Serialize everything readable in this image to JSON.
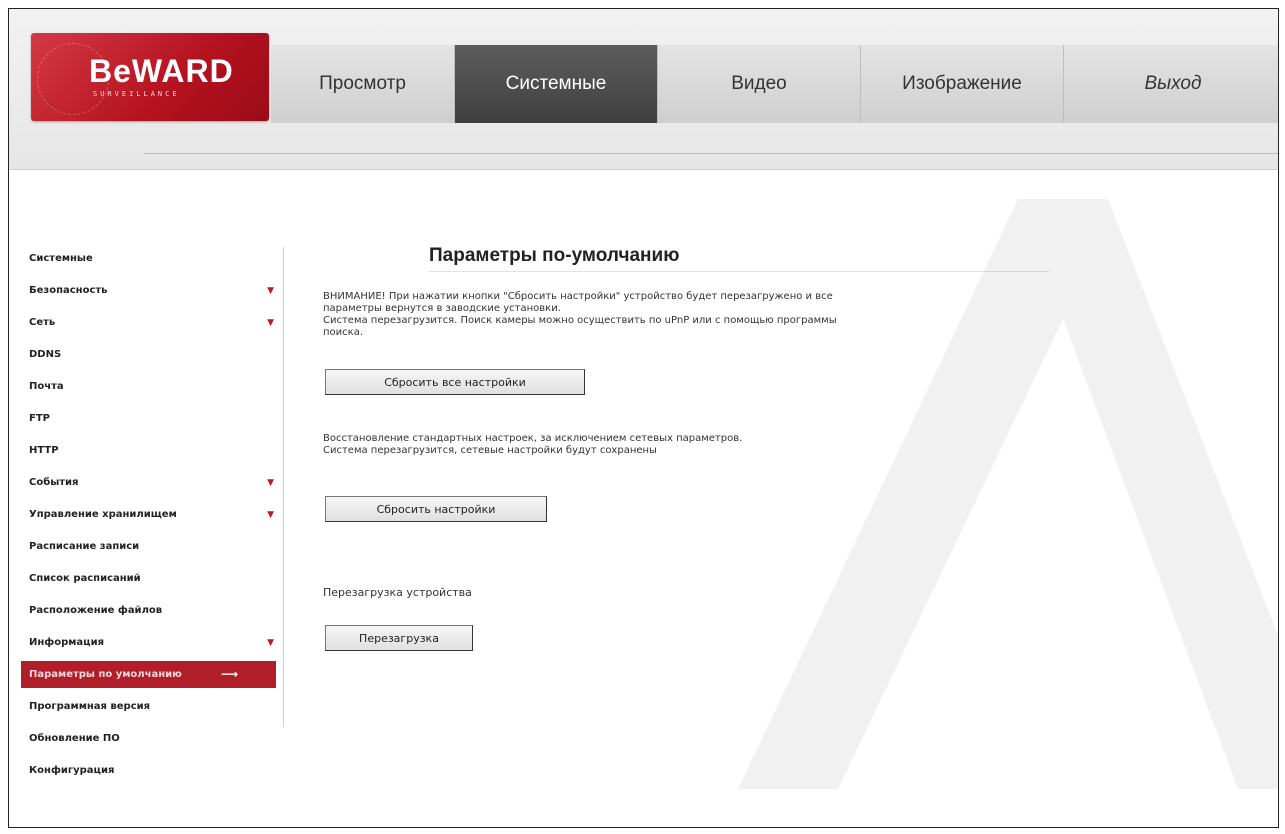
{
  "brand": {
    "logo_text": "BeWARD",
    "logo_sub": "SURVEILLANCE"
  },
  "nav": {
    "tabs": [
      {
        "label": "Просмотр"
      },
      {
        "label": "Системные",
        "active": true
      },
      {
        "label": "Видео"
      },
      {
        "label": "Изображение"
      },
      {
        "label": "Выход"
      }
    ]
  },
  "sidebar": {
    "items": [
      {
        "label": "Системные",
        "has_submenu": false
      },
      {
        "label": "Безопасность",
        "has_submenu": true
      },
      {
        "label": "Сеть",
        "has_submenu": true
      },
      {
        "label": "DDNS",
        "has_submenu": false
      },
      {
        "label": "Почта",
        "has_submenu": false
      },
      {
        "label": "FTP",
        "has_submenu": false
      },
      {
        "label": "HTTP",
        "has_submenu": false
      },
      {
        "label": "События",
        "has_submenu": true
      },
      {
        "label": "Управление хранилищем",
        "has_submenu": true
      },
      {
        "label": "Расписание записи",
        "has_submenu": false
      },
      {
        "label": "Список расписаний",
        "has_submenu": false
      },
      {
        "label": "Расположение файлов",
        "has_submenu": false
      },
      {
        "label": "Информация",
        "has_submenu": true
      },
      {
        "label": "Параметры по умолчанию",
        "has_submenu": false,
        "active": true
      },
      {
        "label": "Программная версия",
        "has_submenu": false
      },
      {
        "label": "Обновление ПО",
        "has_submenu": false
      },
      {
        "label": "Конфигурация",
        "has_submenu": false
      }
    ]
  },
  "main": {
    "title": "Параметры по-умолчанию",
    "warning_line1": "ВНИМАНИЕ! При нажатии кнопки \"Сбросить настройки\" устройство будет перезагружено и все",
    "warning_line2": "параметры вернутся в заводские установки.",
    "warning_line3": "Система перезагрузится. Поиск камеры можно осуществить по uPnP или с помощью программы",
    "warning_line4": "поиска.",
    "reset_all_button": "Сбросить все настройки",
    "restore_line1": "Восстановление стандартных настроек, за исключением сетевых параметров.",
    "restore_line2": "Система перезагрузится, сетевые настройки будут сохранены",
    "reset_button": "Сбросить настройки",
    "reboot_label": "Перезагрузка устройства",
    "reboot_button": "Перезагрузка"
  },
  "colors": {
    "brand_red": "#b01f29",
    "active_tab": "#4a4a4a",
    "submenu_arrow": "#b51b27"
  }
}
